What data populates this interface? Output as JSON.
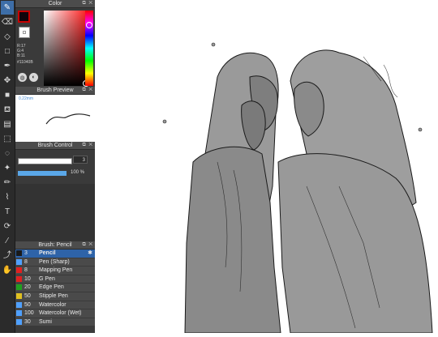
{
  "tools": [
    {
      "icon": "pen-icon",
      "glyph": "✎",
      "active": true
    },
    {
      "icon": "eraser-icon",
      "glyph": "⌫"
    },
    {
      "icon": "eraser-icon",
      "glyph": "◇"
    },
    {
      "icon": "select-icon",
      "glyph": "□"
    },
    {
      "icon": "pen-nib-icon",
      "glyph": "✒"
    },
    {
      "icon": "move-icon",
      "glyph": "✥"
    },
    {
      "icon": "fill-icon",
      "glyph": "■"
    },
    {
      "icon": "bucket-icon",
      "glyph": "⛾"
    },
    {
      "icon": "gradient-icon",
      "glyph": "▤"
    },
    {
      "icon": "marquee-icon",
      "glyph": "⬚"
    },
    {
      "icon": "lasso-icon",
      "glyph": "◌"
    },
    {
      "icon": "magic-wand-icon",
      "glyph": "✦"
    },
    {
      "icon": "pencil-select-icon",
      "glyph": "✏"
    },
    {
      "icon": "brush-select-icon",
      "glyph": "⌇"
    },
    {
      "icon": "text-icon",
      "glyph": "T"
    },
    {
      "icon": "rotate-icon",
      "glyph": "⟳"
    },
    {
      "icon": "eyedropper-icon",
      "glyph": "⁄"
    },
    {
      "icon": "wand-icon",
      "glyph": "⤴"
    },
    {
      "icon": "hand-icon",
      "glyph": "✋"
    }
  ],
  "color_panel": {
    "title": "Color",
    "r": "R:17",
    "g": "G:4",
    "b": "B:11",
    "hex": "#11040B",
    "fg": "#11040b",
    "accent": "#c80000"
  },
  "brush_preview": {
    "title": "Brush Preview",
    "size": "0.22mm"
  },
  "brush_control": {
    "title": "Brush Control",
    "size_value": "3",
    "opacity_value": "100 %"
  },
  "brush_panel": {
    "title": "Brush: Pencil"
  },
  "brushes": [
    {
      "size": "3",
      "name": "Pencil",
      "color": "#1a1a1a",
      "selected": true
    },
    {
      "size": "8",
      "name": "Pen (Sharp)",
      "color": "#4fa0ff"
    },
    {
      "size": "8",
      "name": "Mapping Pen",
      "color": "#e02020"
    },
    {
      "size": "10",
      "name": "G Pen",
      "color": "#e02020"
    },
    {
      "size": "20",
      "name": "Edge Pen",
      "color": "#20a020"
    },
    {
      "size": "50",
      "name": "Stipple Pen",
      "color": "#e0c020"
    },
    {
      "size": "50",
      "name": "Watercolor",
      "color": "#4fa0ff"
    },
    {
      "size": "100",
      "name": "Watercolor (Wet)",
      "color": "#4fa0ff"
    },
    {
      "size": "30",
      "name": "Sumi",
      "color": "#4fa0ff"
    }
  ]
}
